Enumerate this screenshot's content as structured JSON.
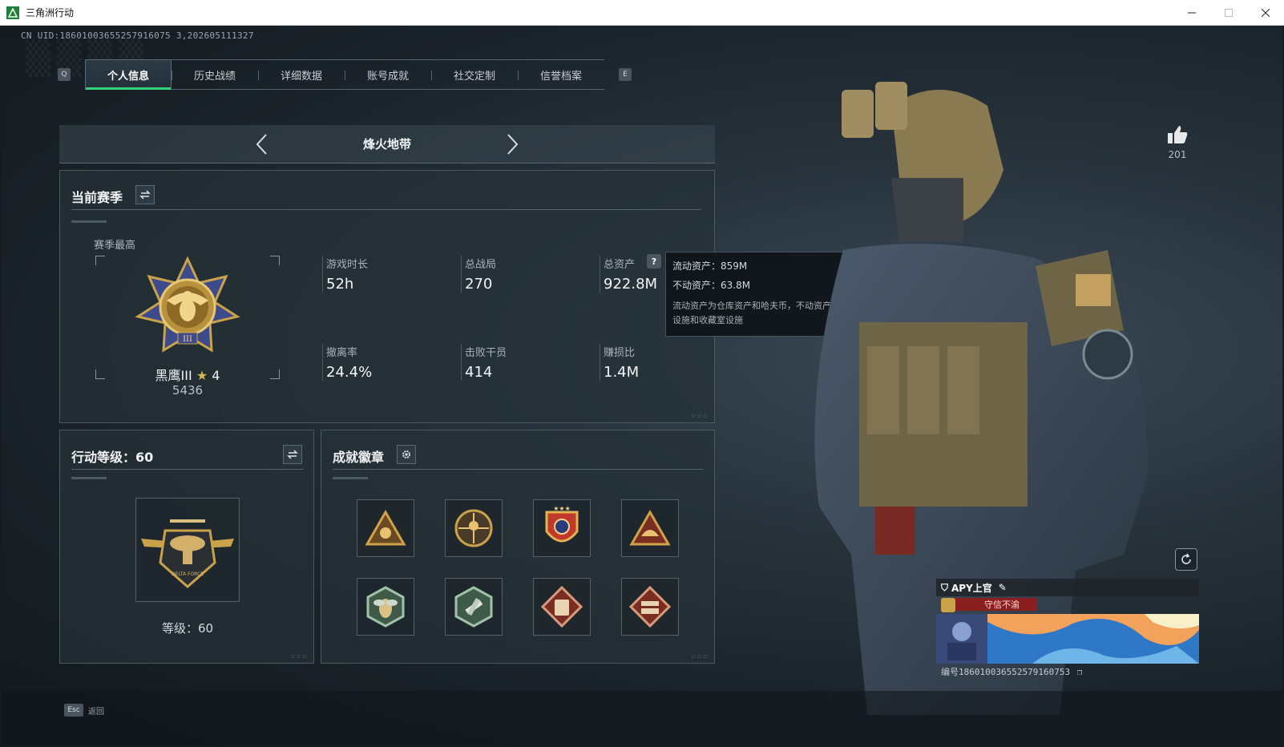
{
  "window": {
    "title": "三角洲行动",
    "controls": [
      "minimize",
      "maximize",
      "close"
    ]
  },
  "uid_text": "CN UID:18601003655257916075 3,202605111327",
  "tabs": {
    "prev_key": "Q",
    "next_key": "E",
    "items": [
      "个人信息",
      "历史战绩",
      "详细数据",
      "账号成就",
      "社交定制",
      "信誉档案"
    ],
    "active_index": 0
  },
  "mode": {
    "name": "烽火地带"
  },
  "season": {
    "title": "当前赛季",
    "highest_label": "赛季最高",
    "rank_name": "黑鹰III",
    "rank_stars": "4",
    "rank_score": "5436",
    "stats": [
      {
        "label": "游戏时长",
        "value": "52h"
      },
      {
        "label": "总战局",
        "value": "270"
      },
      {
        "label": "总资产",
        "value": "922.8M"
      },
      {
        "label": "撤离率",
        "value": "24.4%"
      },
      {
        "label": "击败干员",
        "value": "414"
      },
      {
        "label": "赚损比",
        "value": "1.4M"
      }
    ],
    "help_icon": "?"
  },
  "tooltip": {
    "liquid": "流动资产：859M",
    "fixed": "不动资产：63.8M",
    "desc": "流动资产为仓库资产和哈夫币，不动资产为特勤处设施和收藏室设施"
  },
  "level": {
    "title": "行动等级：60",
    "label": "等级：60",
    "emblem_text": "DELTA FORCE"
  },
  "badges": {
    "title": "成就徽章",
    "items": [
      "badge-1",
      "badge-2",
      "badge-3",
      "badge-4",
      "badge-5",
      "badge-6",
      "badge-7",
      "badge-8"
    ]
  },
  "profile": {
    "likes": "201",
    "player_name": "APY上官",
    "motto": "守信不渝",
    "card_id": "编号186010036552579160753"
  },
  "footer": {
    "esc_key": "Esc",
    "esc_label": "返回"
  },
  "colors": {
    "accent": "#2fd17a",
    "gold": "#c9a24a",
    "motto_bg": "#8b1f1f"
  }
}
